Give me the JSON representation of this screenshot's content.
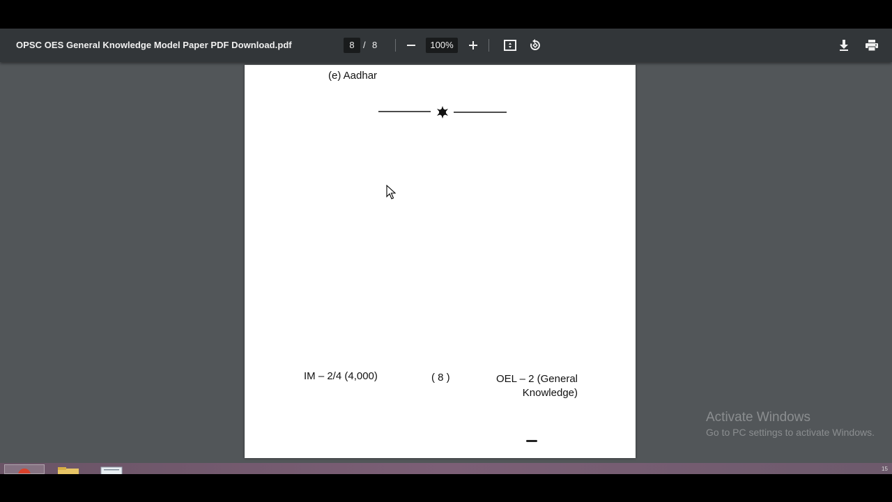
{
  "toolbar": {
    "title": "OPSC OES General Knowledge Model Paper PDF Download.pdf",
    "current_page": "8",
    "page_separator": "/",
    "total_pages": "8",
    "zoom": "100%",
    "icons": [
      "zoom-out-icon",
      "zoom-in-icon",
      "fit-page-icon",
      "rotate-icon",
      "download-icon",
      "print-icon"
    ]
  },
  "page": {
    "option_e": "(e)  Aadhar",
    "footer_left": "IM – 2/4 (4,000)",
    "footer_center": "( 8 )",
    "footer_right_line1": "OEL – 2 (General",
    "footer_right_line2": "Knowledge)"
  },
  "watermark": {
    "title": "Activate Windows",
    "subtitle": "Go to PC settings to activate Windows."
  },
  "taskbar": {
    "clock_fragment": "15"
  },
  "colors": {
    "toolbar_bg": "#323639",
    "viewer_bg": "#525659",
    "page_bg": "#ffffff",
    "taskbar_bg": "#7c5f76"
  }
}
